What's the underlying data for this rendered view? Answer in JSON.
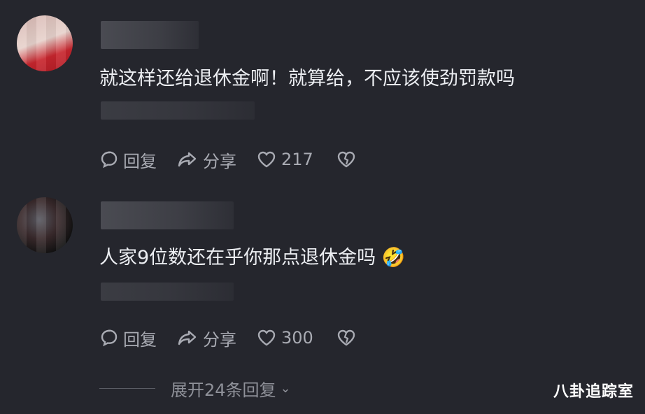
{
  "comments": [
    {
      "text": "就这样还给退休金啊！就算给，不应该使劲罚款吗",
      "reply_label": "回复",
      "share_label": "分享",
      "like_count": "217"
    },
    {
      "text": "人家9位数还在乎你那点退休金吗 🤣",
      "reply_label": "回复",
      "share_label": "分享",
      "like_count": "300"
    }
  ],
  "expand_replies": "展开24条回复",
  "watermark": "八卦追踪室",
  "icons": [
    "comment-icon",
    "share-icon",
    "heart-icon",
    "broken-heart-icon",
    "chevron-down-icon"
  ]
}
